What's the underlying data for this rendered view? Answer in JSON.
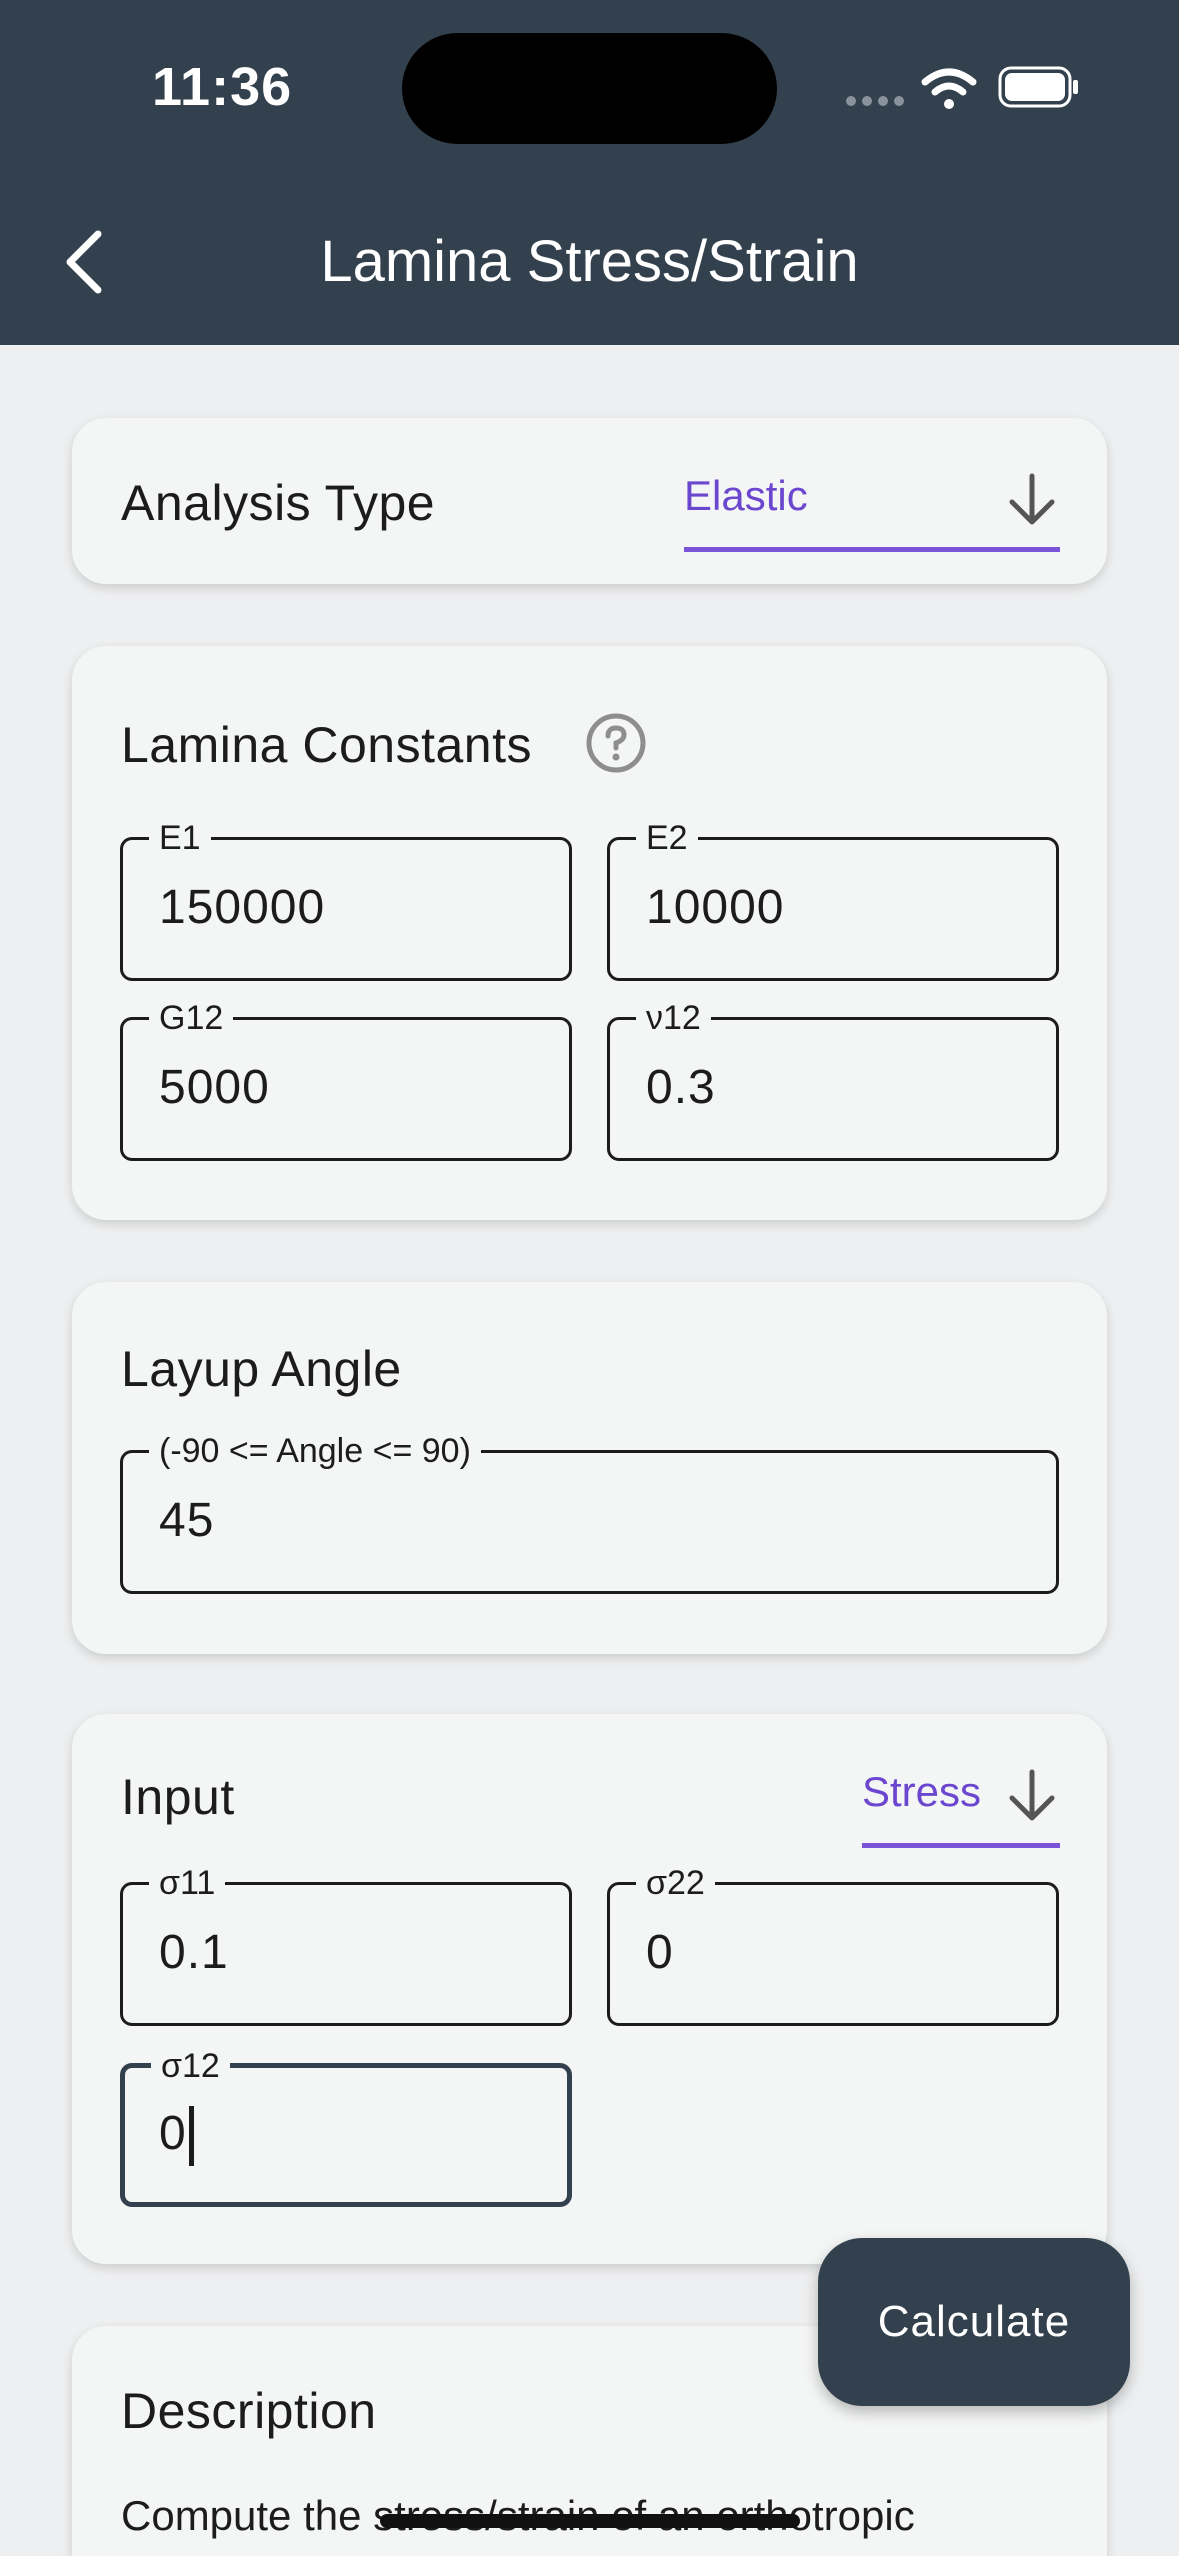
{
  "status_bar": {
    "time": "11:36"
  },
  "header": {
    "title": "Lamina Stress/Strain"
  },
  "analysis": {
    "label": "Analysis Type",
    "selected": "Elastic"
  },
  "constants": {
    "title": "Lamina Constants",
    "fields": [
      {
        "label": "E1",
        "value": "150000"
      },
      {
        "label": "E2",
        "value": "10000"
      },
      {
        "label": "G12",
        "value": "5000"
      },
      {
        "label": "ν12",
        "value": "0.3"
      }
    ]
  },
  "layup": {
    "title": "Layup Angle",
    "label": "(-90 <= Angle <= 90)",
    "value": "45"
  },
  "input": {
    "title": "Input",
    "mode": "Stress",
    "fields": [
      {
        "label": "σ11",
        "value": "0.1"
      },
      {
        "label": "σ22",
        "value": "0"
      },
      {
        "label": "σ12",
        "value": "0"
      }
    ]
  },
  "description": {
    "title": "Description",
    "text": "Compute the stress/strain of an orthotropic"
  },
  "actions": {
    "calculate": "Calculate"
  },
  "colors": {
    "header": "#33404d",
    "accent": "#7a54d8",
    "background": "#eeeff0"
  }
}
